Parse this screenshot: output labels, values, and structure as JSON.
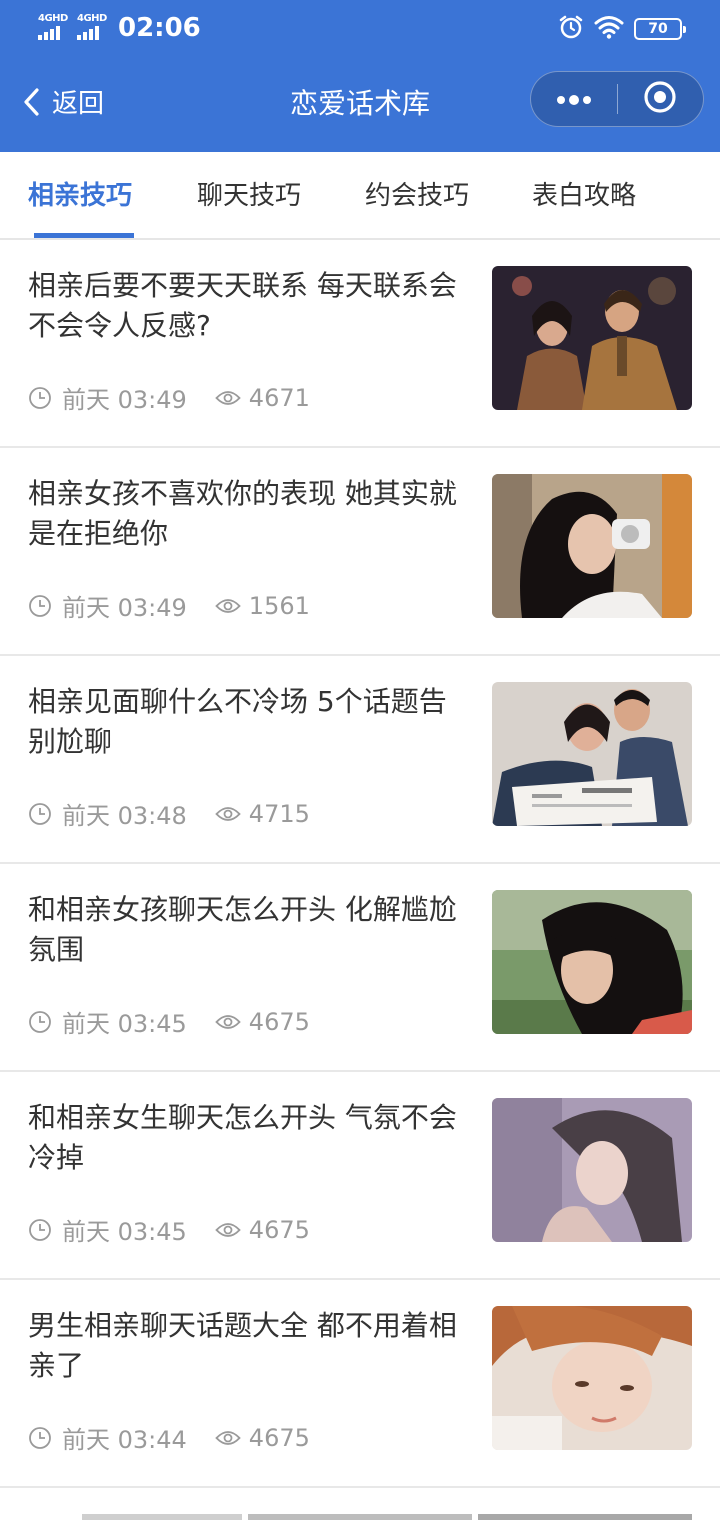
{
  "status_bar": {
    "network_1": "4GHD",
    "network_2": "4GHD",
    "time": "02:06",
    "battery": "70"
  },
  "nav": {
    "back_label": "返回",
    "title": "恋爱话术库",
    "menu_icon": "more-dots-icon",
    "close_icon": "target-circle-icon"
  },
  "tabs": [
    {
      "label": "相亲技巧",
      "active": true
    },
    {
      "label": "聊天技巧",
      "active": false
    },
    {
      "label": "约会技巧",
      "active": false
    },
    {
      "label": "表白攻略",
      "active": false
    }
  ],
  "articles": [
    {
      "title": "相亲后要不要天天联系 每天联系会不会令人反感?",
      "date": "前天 03:49",
      "views": "4671"
    },
    {
      "title": "相亲女孩不喜欢你的表现 她其实就是在拒绝你",
      "date": "前天 03:49",
      "views": "1561"
    },
    {
      "title": "相亲见面聊什么不冷场 5个话题告别尬聊",
      "date": "前天 03:48",
      "views": "4715"
    },
    {
      "title": "和相亲女孩聊天怎么开头 化解尴尬氛围",
      "date": "前天 03:45",
      "views": "4675"
    },
    {
      "title": "和相亲女生聊天怎么开头 气氛不会冷掉",
      "date": "前天 03:45",
      "views": "4675"
    },
    {
      "title": "男生相亲聊天话题大全 都不用着相亲了",
      "date": "前天 03:44",
      "views": "4675"
    }
  ],
  "colors": {
    "brand": "#3b74d6",
    "text": "#333333",
    "meta": "#9a9a9a"
  }
}
